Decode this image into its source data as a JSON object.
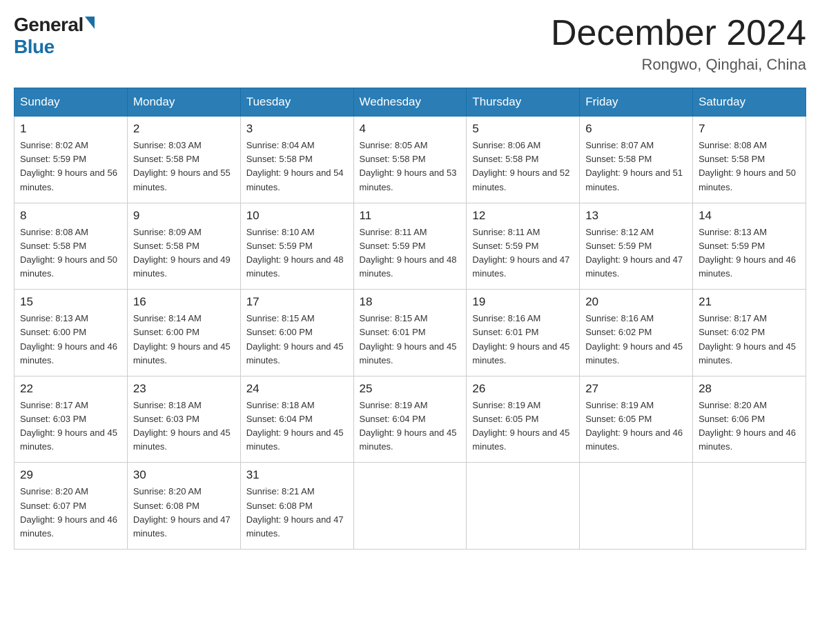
{
  "header": {
    "logo_general": "General",
    "logo_blue": "Blue",
    "month_title": "December 2024",
    "location": "Rongwo, Qinghai, China"
  },
  "days_of_week": [
    "Sunday",
    "Monday",
    "Tuesday",
    "Wednesday",
    "Thursday",
    "Friday",
    "Saturday"
  ],
  "weeks": [
    [
      {
        "day": "1",
        "sunrise": "8:02 AM",
        "sunset": "5:59 PM",
        "daylight": "9 hours and 56 minutes."
      },
      {
        "day": "2",
        "sunrise": "8:03 AM",
        "sunset": "5:58 PM",
        "daylight": "9 hours and 55 minutes."
      },
      {
        "day": "3",
        "sunrise": "8:04 AM",
        "sunset": "5:58 PM",
        "daylight": "9 hours and 54 minutes."
      },
      {
        "day": "4",
        "sunrise": "8:05 AM",
        "sunset": "5:58 PM",
        "daylight": "9 hours and 53 minutes."
      },
      {
        "day": "5",
        "sunrise": "8:06 AM",
        "sunset": "5:58 PM",
        "daylight": "9 hours and 52 minutes."
      },
      {
        "day": "6",
        "sunrise": "8:07 AM",
        "sunset": "5:58 PM",
        "daylight": "9 hours and 51 minutes."
      },
      {
        "day": "7",
        "sunrise": "8:08 AM",
        "sunset": "5:58 PM",
        "daylight": "9 hours and 50 minutes."
      }
    ],
    [
      {
        "day": "8",
        "sunrise": "8:08 AM",
        "sunset": "5:58 PM",
        "daylight": "9 hours and 50 minutes."
      },
      {
        "day": "9",
        "sunrise": "8:09 AM",
        "sunset": "5:58 PM",
        "daylight": "9 hours and 49 minutes."
      },
      {
        "day": "10",
        "sunrise": "8:10 AM",
        "sunset": "5:59 PM",
        "daylight": "9 hours and 48 minutes."
      },
      {
        "day": "11",
        "sunrise": "8:11 AM",
        "sunset": "5:59 PM",
        "daylight": "9 hours and 48 minutes."
      },
      {
        "day": "12",
        "sunrise": "8:11 AM",
        "sunset": "5:59 PM",
        "daylight": "9 hours and 47 minutes."
      },
      {
        "day": "13",
        "sunrise": "8:12 AM",
        "sunset": "5:59 PM",
        "daylight": "9 hours and 47 minutes."
      },
      {
        "day": "14",
        "sunrise": "8:13 AM",
        "sunset": "5:59 PM",
        "daylight": "9 hours and 46 minutes."
      }
    ],
    [
      {
        "day": "15",
        "sunrise": "8:13 AM",
        "sunset": "6:00 PM",
        "daylight": "9 hours and 46 minutes."
      },
      {
        "day": "16",
        "sunrise": "8:14 AM",
        "sunset": "6:00 PM",
        "daylight": "9 hours and 45 minutes."
      },
      {
        "day": "17",
        "sunrise": "8:15 AM",
        "sunset": "6:00 PM",
        "daylight": "9 hours and 45 minutes."
      },
      {
        "day": "18",
        "sunrise": "8:15 AM",
        "sunset": "6:01 PM",
        "daylight": "9 hours and 45 minutes."
      },
      {
        "day": "19",
        "sunrise": "8:16 AM",
        "sunset": "6:01 PM",
        "daylight": "9 hours and 45 minutes."
      },
      {
        "day": "20",
        "sunrise": "8:16 AM",
        "sunset": "6:02 PM",
        "daylight": "9 hours and 45 minutes."
      },
      {
        "day": "21",
        "sunrise": "8:17 AM",
        "sunset": "6:02 PM",
        "daylight": "9 hours and 45 minutes."
      }
    ],
    [
      {
        "day": "22",
        "sunrise": "8:17 AM",
        "sunset": "6:03 PM",
        "daylight": "9 hours and 45 minutes."
      },
      {
        "day": "23",
        "sunrise": "8:18 AM",
        "sunset": "6:03 PM",
        "daylight": "9 hours and 45 minutes."
      },
      {
        "day": "24",
        "sunrise": "8:18 AM",
        "sunset": "6:04 PM",
        "daylight": "9 hours and 45 minutes."
      },
      {
        "day": "25",
        "sunrise": "8:19 AM",
        "sunset": "6:04 PM",
        "daylight": "9 hours and 45 minutes."
      },
      {
        "day": "26",
        "sunrise": "8:19 AM",
        "sunset": "6:05 PM",
        "daylight": "9 hours and 45 minutes."
      },
      {
        "day": "27",
        "sunrise": "8:19 AM",
        "sunset": "6:05 PM",
        "daylight": "9 hours and 46 minutes."
      },
      {
        "day": "28",
        "sunrise": "8:20 AM",
        "sunset": "6:06 PM",
        "daylight": "9 hours and 46 minutes."
      }
    ],
    [
      {
        "day": "29",
        "sunrise": "8:20 AM",
        "sunset": "6:07 PM",
        "daylight": "9 hours and 46 minutes."
      },
      {
        "day": "30",
        "sunrise": "8:20 AM",
        "sunset": "6:08 PM",
        "daylight": "9 hours and 47 minutes."
      },
      {
        "day": "31",
        "sunrise": "8:21 AM",
        "sunset": "6:08 PM",
        "daylight": "9 hours and 47 minutes."
      },
      null,
      null,
      null,
      null
    ]
  ]
}
